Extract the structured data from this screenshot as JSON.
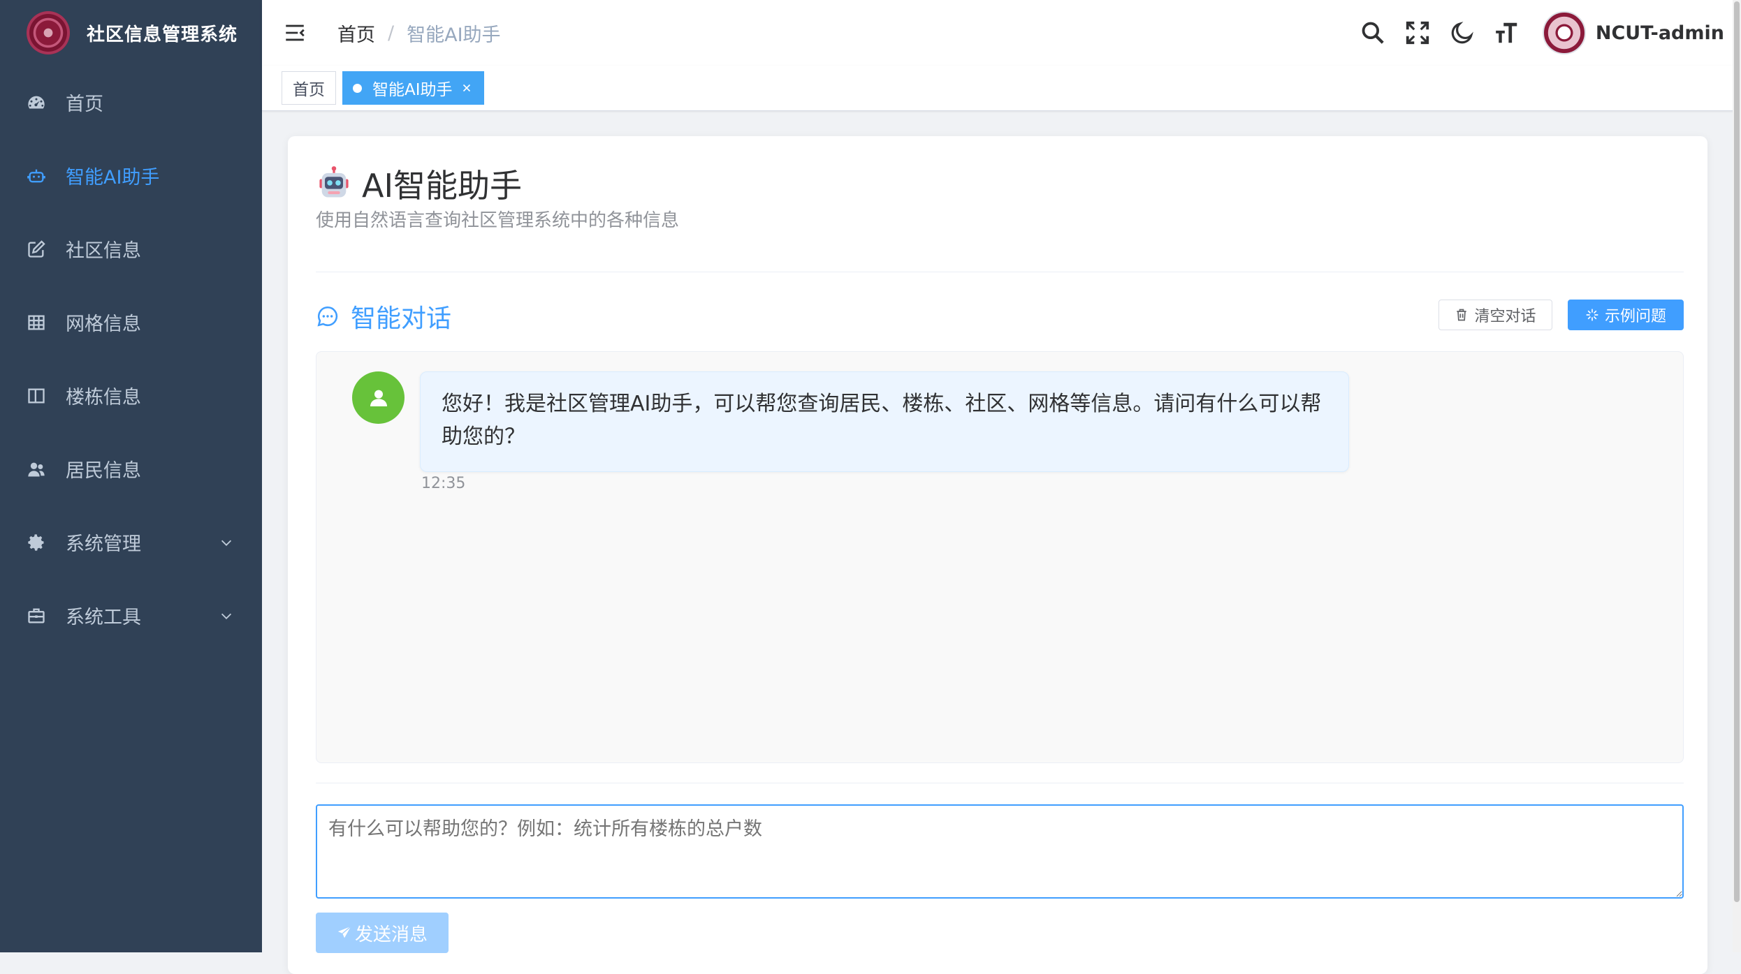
{
  "brand": {
    "title": "社区信息管理系统"
  },
  "sidebar": {
    "items": [
      {
        "label": "首页",
        "icon": "dashboard-icon"
      },
      {
        "label": "智能AI助手",
        "icon": "robot-icon",
        "active": true
      },
      {
        "label": "社区信息",
        "icon": "edit-icon"
      },
      {
        "label": "网格信息",
        "icon": "grid-table-icon"
      },
      {
        "label": "楼栋信息",
        "icon": "building-icon"
      },
      {
        "label": "居民信息",
        "icon": "people-icon"
      },
      {
        "label": "系统管理",
        "icon": "gear-icon",
        "expandable": true
      },
      {
        "label": "系统工具",
        "icon": "toolbox-icon",
        "expandable": true
      }
    ]
  },
  "navbar": {
    "breadcrumb": {
      "home": "首页",
      "separator": "/",
      "current": "智能AI助手"
    },
    "username": "NCUT-admin",
    "icons": [
      "search-icon",
      "fullscreen-icon",
      "dark-mode-icon",
      "font-size-icon"
    ]
  },
  "tags": [
    {
      "label": "首页"
    },
    {
      "label": "智能AI助手",
      "active": true
    }
  ],
  "page": {
    "title": "AI智能助手",
    "subtitle": "使用自然语言查询社区管理系统中的各种信息"
  },
  "chat": {
    "title": "智能对话",
    "clear_label": "清空对话",
    "example_label": "示例问题",
    "messages": [
      {
        "text": "您好！我是社区管理AI助手，可以帮您查询居民、楼栋、社区、网格等信息。请问有什么可以帮助您的？",
        "time": "12:35"
      }
    ],
    "input_placeholder": "有什么可以帮助您的？例如：统计所有楼栋的总户数",
    "send_label": "发送消息"
  },
  "colors": {
    "sidebar_bg": "#304156",
    "primary": "#409eff",
    "avatar_green": "#67c23a",
    "send_disabled": "#a0cfff"
  }
}
